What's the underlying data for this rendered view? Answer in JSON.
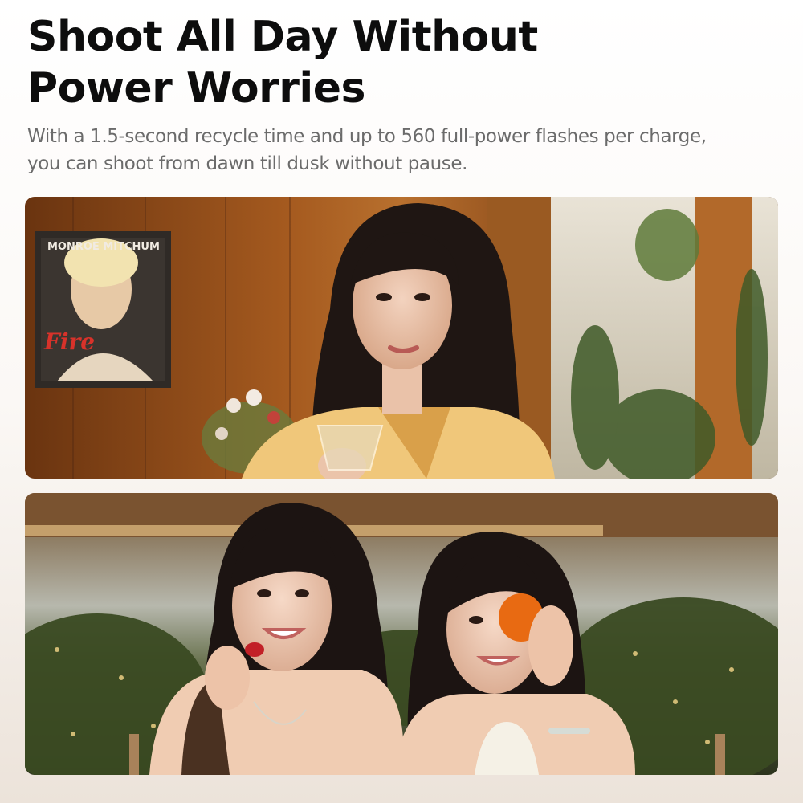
{
  "headline": {
    "line1": "Shoot All Day Without",
    "line2": "Power Worries"
  },
  "description": {
    "line1": "With a 1.5-second recycle time and up to 560 full-power flashes per charge,",
    "line2": "you can shoot from dawn till dusk without pause."
  },
  "photo_top": {
    "poster_text": "MONROE MITCHUM",
    "poster_script": "Fire"
  },
  "photo_bottom": {}
}
